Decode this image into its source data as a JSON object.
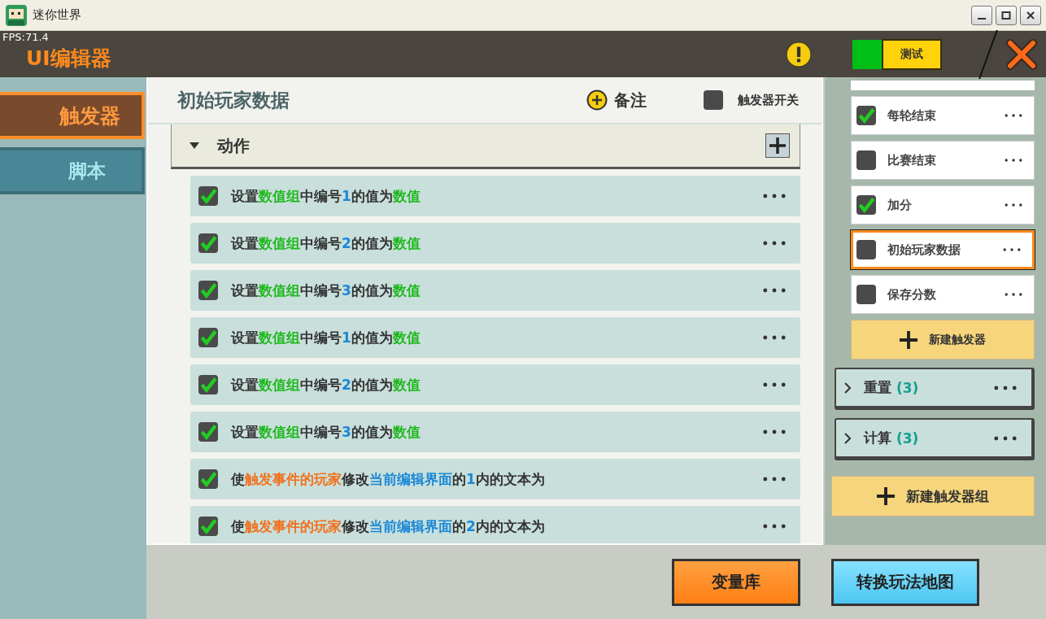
{
  "window": {
    "title": "迷你世界"
  },
  "fps": "FPS:71.4",
  "editor_title": "UI编辑器",
  "test_button": "测试",
  "sidebar": {
    "tabs": [
      {
        "label": "触发器",
        "selected": true
      },
      {
        "label": "脚本",
        "selected": false
      }
    ]
  },
  "trigger": {
    "title": "初始玩家数据",
    "note_button": "备注",
    "switch": {
      "label": "触发器开关",
      "checked": false
    }
  },
  "actions": {
    "title": "动作",
    "expanded": true,
    "items": [
      {
        "checked": true,
        "segments": [
          {
            "kind": "plain",
            "text": "设置"
          },
          {
            "kind": "var",
            "text": "数值组"
          },
          {
            "kind": "plain",
            "text": "中编号"
          },
          {
            "kind": "num",
            "text": "1"
          },
          {
            "kind": "plain",
            "text": "的值为"
          },
          {
            "kind": "var",
            "text": "数值"
          }
        ]
      },
      {
        "checked": true,
        "segments": [
          {
            "kind": "plain",
            "text": "设置"
          },
          {
            "kind": "var",
            "text": "数值组"
          },
          {
            "kind": "plain",
            "text": "中编号"
          },
          {
            "kind": "num",
            "text": "2"
          },
          {
            "kind": "plain",
            "text": "的值为"
          },
          {
            "kind": "var",
            "text": "数值"
          }
        ]
      },
      {
        "checked": true,
        "segments": [
          {
            "kind": "plain",
            "text": "设置"
          },
          {
            "kind": "var",
            "text": "数值组"
          },
          {
            "kind": "plain",
            "text": "中编号"
          },
          {
            "kind": "num",
            "text": "3"
          },
          {
            "kind": "plain",
            "text": "的值为"
          },
          {
            "kind": "var",
            "text": "数值"
          }
        ]
      },
      {
        "checked": true,
        "segments": [
          {
            "kind": "plain",
            "text": "设置"
          },
          {
            "kind": "var",
            "text": "数值组"
          },
          {
            "kind": "plain",
            "text": "中编号"
          },
          {
            "kind": "num",
            "text": "1"
          },
          {
            "kind": "plain",
            "text": "的值为"
          },
          {
            "kind": "var",
            "text": "数值"
          }
        ]
      },
      {
        "checked": true,
        "segments": [
          {
            "kind": "plain",
            "text": "设置"
          },
          {
            "kind": "var",
            "text": "数值组"
          },
          {
            "kind": "plain",
            "text": "中编号"
          },
          {
            "kind": "num",
            "text": "2"
          },
          {
            "kind": "plain",
            "text": "的值为"
          },
          {
            "kind": "var",
            "text": "数值"
          }
        ]
      },
      {
        "checked": true,
        "segments": [
          {
            "kind": "plain",
            "text": "设置"
          },
          {
            "kind": "var",
            "text": "数值组"
          },
          {
            "kind": "plain",
            "text": "中编号"
          },
          {
            "kind": "num",
            "text": "3"
          },
          {
            "kind": "plain",
            "text": "的值为"
          },
          {
            "kind": "var",
            "text": "数值"
          }
        ]
      },
      {
        "checked": true,
        "segments": [
          {
            "kind": "plain",
            "text": "使"
          },
          {
            "kind": "player",
            "text": "触发事件的玩家"
          },
          {
            "kind": "plain",
            "text": "修改"
          },
          {
            "kind": "ui",
            "text": "当前编辑界面"
          },
          {
            "kind": "plain",
            "text": "的"
          },
          {
            "kind": "num",
            "text": "1"
          },
          {
            "kind": "plain",
            "text": "内的文本为"
          }
        ]
      },
      {
        "checked": true,
        "segments": [
          {
            "kind": "plain",
            "text": "使"
          },
          {
            "kind": "player",
            "text": "触发事件的玩家"
          },
          {
            "kind": "plain",
            "text": "修改"
          },
          {
            "kind": "ui",
            "text": "当前编辑界面"
          },
          {
            "kind": "plain",
            "text": "的"
          },
          {
            "kind": "num",
            "text": "2"
          },
          {
            "kind": "plain",
            "text": "内的文本为"
          }
        ]
      }
    ]
  },
  "triggers": [
    {
      "label": "每轮结束",
      "checked": true,
      "selected": false
    },
    {
      "label": "比赛结束",
      "checked": false,
      "selected": false
    },
    {
      "label": "加分",
      "checked": true,
      "selected": false
    },
    {
      "label": "初始玩家数据",
      "checked": false,
      "selected": true
    },
    {
      "label": "保存分数",
      "checked": false,
      "selected": false
    }
  ],
  "new_trigger_button": "新建触发器",
  "groups": [
    {
      "name": "重置",
      "count": "(3)",
      "expanded": false
    },
    {
      "name": "计算",
      "count": "(3)",
      "expanded": false
    }
  ],
  "new_group_button": "新建触发器组",
  "bottom_buttons": [
    {
      "label": "变量库",
      "kind": "orange"
    },
    {
      "label": "转换玩法地图",
      "kind": "cyan"
    }
  ]
}
